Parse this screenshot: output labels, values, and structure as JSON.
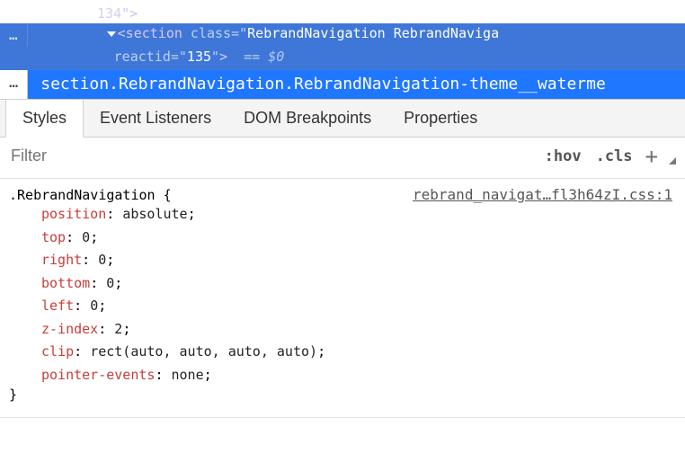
{
  "domTree": {
    "line0": "134",
    "line0_tail": "\">",
    "ellipsis": "…",
    "highlighted": {
      "triangle": true,
      "open_angle": "<",
      "tag": "section",
      "attr1_name": "class",
      "attr1_eq": "=",
      "attr1_qo": "\"",
      "attr1_val": "RebrandNavigation RebrandNaviga",
      "cont_attr": "reactid",
      "cont_eq": "=",
      "cont_qo": "\"",
      "cont_val": "135",
      "cont_qc": "\"",
      "cont_close": ">",
      "eqeq": "==",
      "cursor": "$0"
    }
  },
  "breadcrumb": {
    "ellipsis": "…",
    "text": "section.RebrandNavigation.RebrandNavigation-theme__waterme"
  },
  "tabs": {
    "styles": "Styles",
    "eventListeners": "Event Listeners",
    "domBreakpoints": "DOM Breakpoints",
    "properties": "Properties"
  },
  "toolbar": {
    "filter_placeholder": "Filter",
    "hov": ":hov",
    "cls": ".cls",
    "plus": "+"
  },
  "rule": {
    "selector": ".RebrandNavigation",
    "open_brace": "{",
    "source": "rebrand_navigat…fl3h64zI.css:1",
    "declarations": [
      {
        "prop": "position",
        "val": "absolute"
      },
      {
        "prop": "top",
        "val": "0"
      },
      {
        "prop": "right",
        "val": "0"
      },
      {
        "prop": "bottom",
        "val": "0"
      },
      {
        "prop": "left",
        "val": "0"
      },
      {
        "prop": "z-index",
        "val": "2"
      },
      {
        "prop": "clip",
        "val": "rect(auto, auto, auto, auto)"
      },
      {
        "prop": "pointer-events",
        "val": "none"
      }
    ],
    "close_brace": "}"
  }
}
